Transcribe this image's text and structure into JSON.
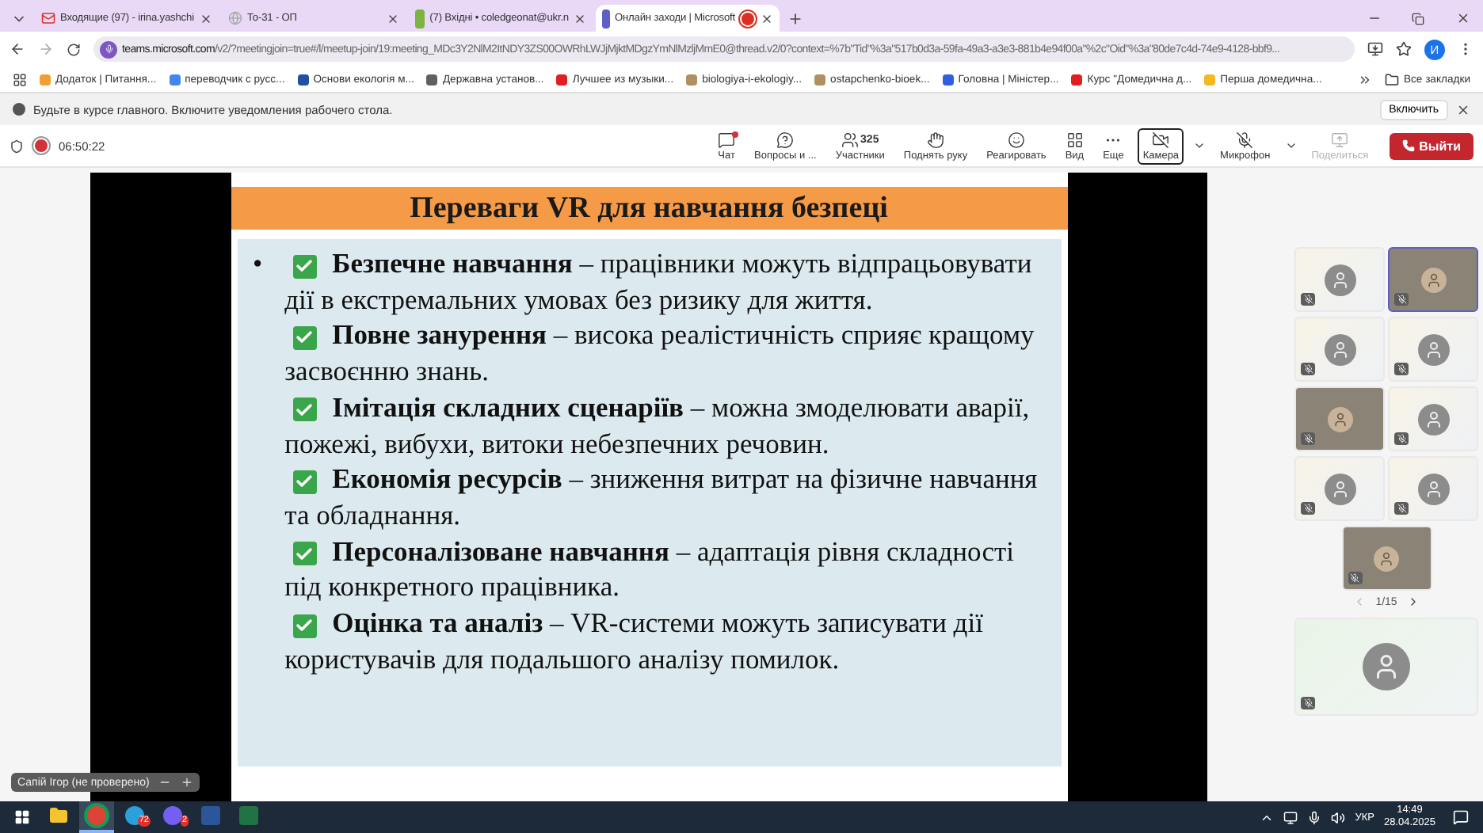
{
  "browser": {
    "tabs": [
      {
        "title": "Входящие (97) - irina.yashchi",
        "kind": "mail",
        "selected": false
      },
      {
        "title": "То-31 - ОП",
        "kind": "blank",
        "selected": false
      },
      {
        "title": "(7) Вхідні • coledgeonat@ukr.n",
        "kind": "ukrnet",
        "selected": false
      },
      {
        "title": "Онлайн заходи | Microsoft",
        "kind": "teams",
        "selected": true,
        "recording": true
      }
    ],
    "url_host": "teams.microsoft.com",
    "url_path": "/v2/?meetingjoin=true#/l/meetup-join/19:meeting_MDc3Y2NlM2ItNDY3ZS00OWRhLWJjMjktMDgzYmNlMzljMmE0@thread.v2/0?context=%7b\"Tid\"%3a\"517b0d3a-59fa-49a3-a3e3-881b4e94f00a\"%2c\"Oid\"%3a\"80de7c4d-74e9-4128-bbf9...",
    "profile": "И",
    "bookmarks": [
      {
        "label": "Додаток | Питання...",
        "color": "#f0a030"
      },
      {
        "label": "переводчик с русс...",
        "color": "#4285f4"
      },
      {
        "label": "Основи екологія м...",
        "color": "#2050a0"
      },
      {
        "label": "Державна установ...",
        "color": "#606060"
      },
      {
        "label": "Лучшее из музыки...",
        "color": "#e02020"
      },
      {
        "label": "biologiya-i-ekologiy...",
        "color": "#b09060"
      },
      {
        "label": "ostapchenko-bioek...",
        "color": "#b09060"
      },
      {
        "label": "Головна | Міністер...",
        "color": "#3060e0"
      },
      {
        "label": "Курс \"Домедична д...",
        "color": "#e02020"
      },
      {
        "label": "Перша домедична...",
        "color": "#f5b820"
      }
    ],
    "all_bookmarks": "Все закладки",
    "notice": {
      "text": "Будьте в курсе главного. Включите уведомления рабочего стола.",
      "button": "Включить"
    }
  },
  "meeting": {
    "timer": "06:50:22",
    "tools": [
      {
        "label": "Чат",
        "alert": true
      },
      {
        "label": "Вопросы и ..."
      },
      {
        "label": "Участники",
        "count": "325"
      },
      {
        "label": "Поднять руку"
      },
      {
        "label": "Реагировать"
      },
      {
        "label": "Вид"
      },
      {
        "label": "Еще"
      },
      {
        "label": "Камера",
        "selected": true,
        "dropdown": true
      },
      {
        "label": "Микрофон",
        "dropdown": true
      },
      {
        "label": "Поделиться",
        "disabled": true
      }
    ],
    "leave": "Выйти"
  },
  "slide": {
    "title": "Переваги VR для навчання безпеці",
    "bullet": "•",
    "items": [
      "**Безпечне навчання** – працівники можуть відпрацьовувати дії в екстремальних умовах без ризику для життя.",
      "**Повне занурення** – висока реалістичність сприяє кращому засвоєнню знань.",
      "**Імітація складних сценаріїв** – можна змоделювати аварії, пожежі, вибухи, витоки небезпечних речовин.",
      "**Економія ресурсів** – зниження витрат на фізичне навчання та обладнання.",
      "**Персоналізоване навчання** – адаптація рівня складності під конкретного працівника.",
      "**Оцінка та аналіз** – VR-системи можуть записувати дії користувачів для подальшого аналізу помилок."
    ]
  },
  "presenter_tag": "Сапій Ігор (не проверено)",
  "participants": [
    {
      "kind": "avatar",
      "speaking": false
    },
    {
      "kind": "video",
      "speaking": true
    },
    {
      "kind": "avatar",
      "speaking": false
    },
    {
      "kind": "avatar",
      "speaking": false
    },
    {
      "kind": "video",
      "speaking": false
    },
    {
      "kind": "avatar",
      "speaking": false
    },
    {
      "kind": "avatar",
      "speaking": false
    },
    {
      "kind": "avatar",
      "speaking": false
    },
    {
      "kind": "video",
      "speaking": false
    }
  ],
  "pager": "1/15",
  "pinned": {
    "kind": "avatar"
  },
  "taskbar": {
    "apps": [
      {
        "kind": "explorer"
      },
      {
        "kind": "chrome",
        "selected": true
      },
      {
        "kind": "telegram",
        "badge": "72"
      },
      {
        "kind": "viber",
        "badge": "2"
      },
      {
        "kind": "word"
      },
      {
        "kind": "excel"
      }
    ],
    "lang": "УКР",
    "time": "14:49",
    "date": "28.04.2025"
  }
}
